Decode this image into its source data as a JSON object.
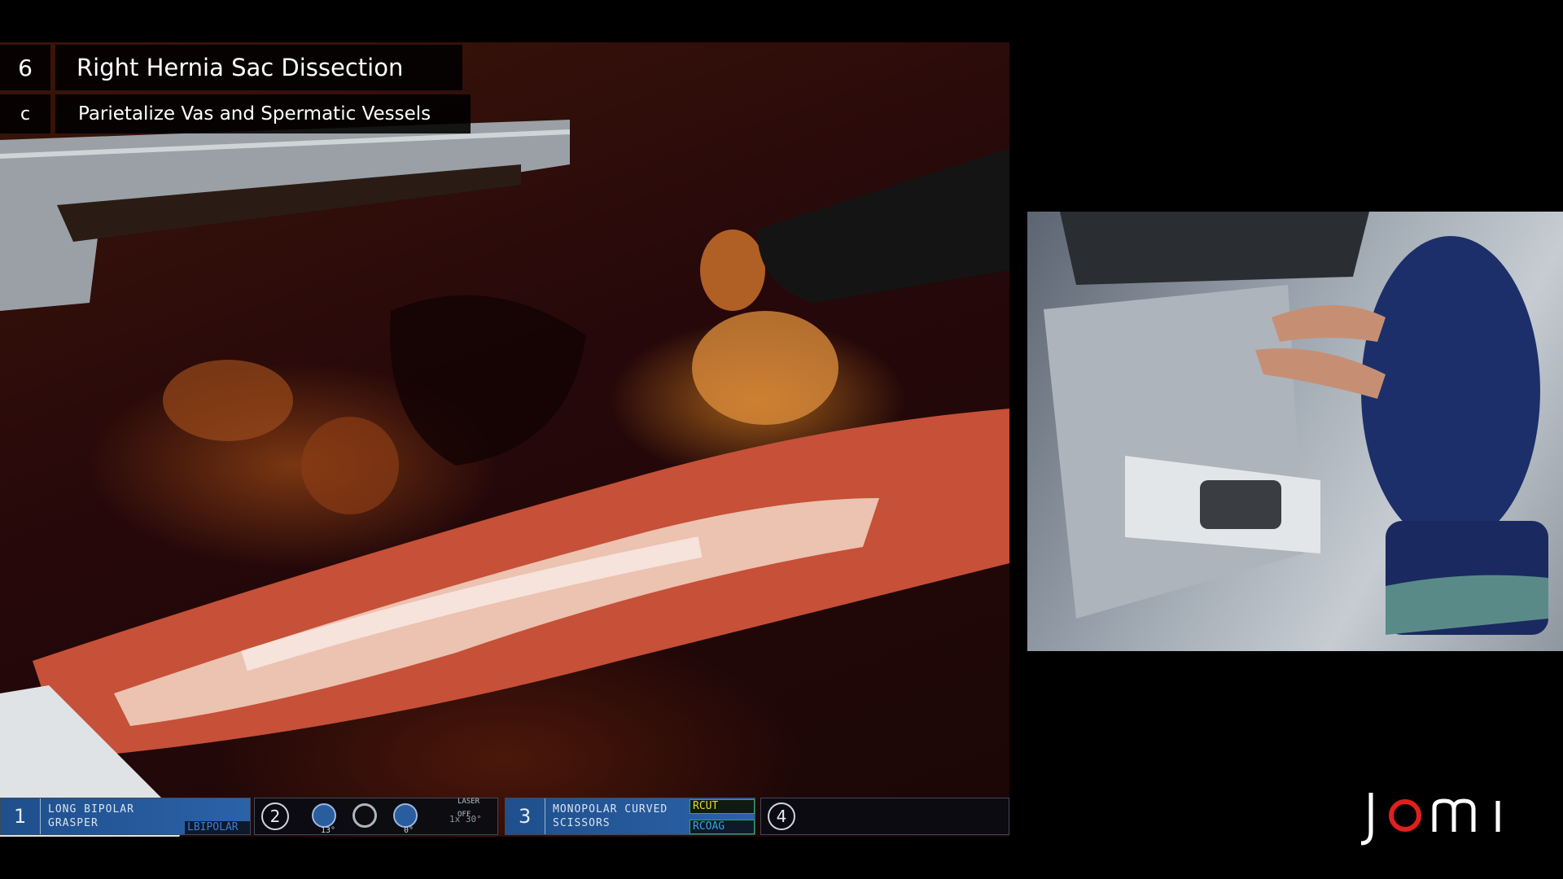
{
  "chapter": {
    "number": "6",
    "title": "Right Hernia Sac Dissection",
    "sub_number": "c",
    "sub_title": "Parietalize Vas and Spermatic Vessels"
  },
  "hud": {
    "arm1": {
      "number": "1",
      "tool": [
        "LONG BIPOLAR",
        "GRASPER"
      ],
      "energy": "BIPOLAR",
      "energy_prefix": "L"
    },
    "arm2": {
      "number": "2",
      "laser": "LASER OFF",
      "angle_left": "13°",
      "angle_right": "0°",
      "zoom": "1x  30°"
    },
    "arm3": {
      "number": "3",
      "tool": [
        "MONOPOLAR CURVED",
        "SCISSORS"
      ],
      "cut": "CUT",
      "cut_prefix": "R",
      "coag": "COAG",
      "coag_prefix": "R"
    },
    "arm4": {
      "number": "4"
    }
  },
  "logo": {
    "text": "jomi"
  },
  "colors": {
    "hud_border": "#3d4a5c",
    "cut_yellow": "#e8d830",
    "coag_blue": "#3aa0e8",
    "logo_red": "#e0201c"
  }
}
